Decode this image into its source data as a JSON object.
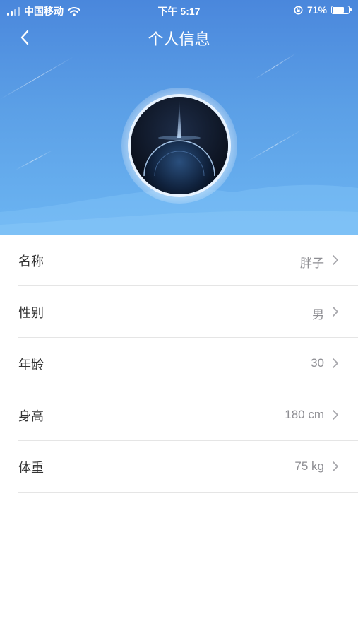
{
  "status_bar": {
    "carrier": "中国移动",
    "time": "下午 5:17",
    "battery_percent": "71%",
    "battery_level": 0.71,
    "icons": [
      "signal-icon",
      "wifi-icon",
      "orientation-lock-icon",
      "battery-icon"
    ]
  },
  "nav": {
    "title": "个人信息",
    "back_icon": "chevron-left-icon"
  },
  "colors": {
    "header_top": "#4a87dc",
    "header_bottom": "#6cb5f2",
    "label_text": "#333333",
    "value_text": "#8e8e93",
    "divider": "#e5e5e5"
  },
  "profile": {
    "rows": [
      {
        "label": "名称",
        "value": "胖子"
      },
      {
        "label": "性别",
        "value": "男"
      },
      {
        "label": "年龄",
        "value": "30"
      },
      {
        "label": "身高",
        "value": "180 cm"
      },
      {
        "label": "体重",
        "value": "75 kg"
      }
    ]
  }
}
